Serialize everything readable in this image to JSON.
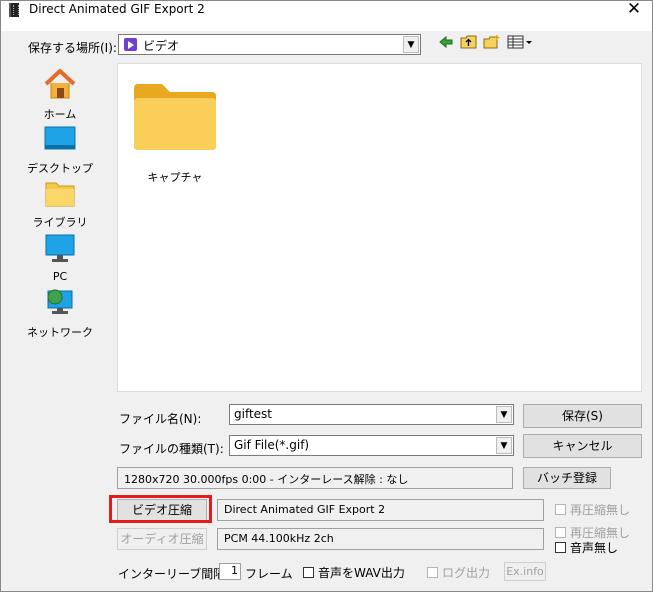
{
  "window": {
    "title": "Direct Animated GIF Export 2",
    "close": "✕"
  },
  "location": {
    "label": "保存する場所(I):",
    "value": "ビデオ"
  },
  "places": [
    {
      "label": "ホーム",
      "icon": "home-icon"
    },
    {
      "label": "デスクトップ",
      "icon": "desktop-icon"
    },
    {
      "label": "ライブラリ",
      "icon": "library-folder-icon"
    },
    {
      "label": "PC",
      "icon": "pc-icon"
    },
    {
      "label": "ネットワーク",
      "icon": "network-icon"
    }
  ],
  "files": [
    {
      "name": "キャプチャ",
      "icon": "folder-icon"
    }
  ],
  "filename": {
    "label": "ファイル名(N):",
    "value": "giftest"
  },
  "filetype": {
    "label": "ファイルの種類(T):",
    "value": "Gif File(*.gif)"
  },
  "buttons": {
    "save": "保存(S)",
    "cancel": "キャンセル",
    "batch": "バッチ登録",
    "video_compress": "ビデオ圧縮",
    "audio_compress": "オーディオ圧縮",
    "exinfo": "Ex.info"
  },
  "info": {
    "video_info": "1280x720  30.000fps  0:00  -  インターレース解除 : なし",
    "video_codec": "Direct Animated GIF Export 2",
    "audio_codec": "PCM 44.100kHz 2ch"
  },
  "checkboxes": {
    "video_recompress_none": "再圧縮無し",
    "audio_recompress_none": "再圧縮無し",
    "no_audio": "音声無し",
    "wav_out": "音声をWAV出力",
    "log_out": "ログ出力"
  },
  "interleave": {
    "label": "インターリーブ間隔 :",
    "value": "1",
    "unit": "フレーム"
  },
  "colors": {
    "highlight": "#e41b1b",
    "folder": "#f6c84a"
  }
}
